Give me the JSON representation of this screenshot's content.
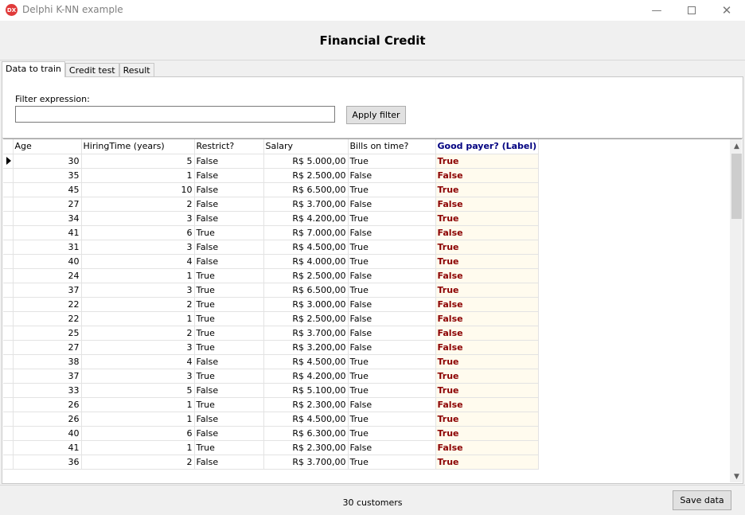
{
  "window": {
    "title": "Delphi K-NN example",
    "icon_text": "DX",
    "minimize_glyph": "—",
    "close_glyph": "✕",
    "colors": {
      "icon": "#e03a3a"
    }
  },
  "header": {
    "title": "Financial Credit"
  },
  "tabs": [
    {
      "label": "Data to train",
      "active": true
    },
    {
      "label": "Credit test",
      "active": false
    },
    {
      "label": "Result",
      "active": false
    }
  ],
  "filter": {
    "label": "Filter expression:",
    "value": "",
    "apply_label": "Apply filter"
  },
  "grid": {
    "columns": [
      "Age",
      "HiringTime (years)",
      "Restrict?",
      "Salary",
      "Bills on time?",
      "Good payer? (Label)"
    ],
    "rows": [
      [
        "30",
        "5",
        "False",
        "R$ 5.000,00",
        "True",
        "True"
      ],
      [
        "35",
        "1",
        "False",
        "R$ 2.500,00",
        "False",
        "False"
      ],
      [
        "45",
        "10",
        "False",
        "R$ 6.500,00",
        "True",
        "True"
      ],
      [
        "27",
        "2",
        "False",
        "R$ 3.700,00",
        "False",
        "False"
      ],
      [
        "34",
        "3",
        "False",
        "R$ 4.200,00",
        "True",
        "True"
      ],
      [
        "41",
        "6",
        "True",
        "R$ 7.000,00",
        "False",
        "False"
      ],
      [
        "31",
        "3",
        "False",
        "R$ 4.500,00",
        "True",
        "True"
      ],
      [
        "40",
        "4",
        "False",
        "R$ 4.000,00",
        "True",
        "True"
      ],
      [
        "24",
        "1",
        "True",
        "R$ 2.500,00",
        "False",
        "False"
      ],
      [
        "37",
        "3",
        "True",
        "R$ 6.500,00",
        "True",
        "True"
      ],
      [
        "22",
        "2",
        "True",
        "R$ 3.000,00",
        "False",
        "False"
      ],
      [
        "22",
        "1",
        "True",
        "R$ 2.500,00",
        "False",
        "False"
      ],
      [
        "25",
        "2",
        "True",
        "R$ 3.700,00",
        "False",
        "False"
      ],
      [
        "27",
        "3",
        "True",
        "R$ 3.200,00",
        "False",
        "False"
      ],
      [
        "38",
        "4",
        "False",
        "R$ 4.500,00",
        "True",
        "True"
      ],
      [
        "37",
        "3",
        "True",
        "R$ 4.200,00",
        "True",
        "True"
      ],
      [
        "33",
        "5",
        "False",
        "R$ 5.100,00",
        "True",
        "True"
      ],
      [
        "26",
        "1",
        "True",
        "R$ 2.300,00",
        "False",
        "False"
      ],
      [
        "26",
        "1",
        "False",
        "R$ 4.500,00",
        "True",
        "True"
      ],
      [
        "40",
        "6",
        "False",
        "R$ 6.300,00",
        "True",
        "True"
      ],
      [
        "41",
        "1",
        "True",
        "R$ 2.300,00",
        "False",
        "False"
      ],
      [
        "36",
        "2",
        "False",
        "R$ 3.700,00",
        "True",
        "True"
      ]
    ],
    "selected_row": 0,
    "scroll_up_glyph": "▲",
    "scroll_down_glyph": "▼",
    "colors": {
      "label_header": "#000080",
      "label_value": "#8b0000",
      "label_background": "#fffbee"
    }
  },
  "status": {
    "text": "30 customers",
    "save_label": "Save data"
  }
}
